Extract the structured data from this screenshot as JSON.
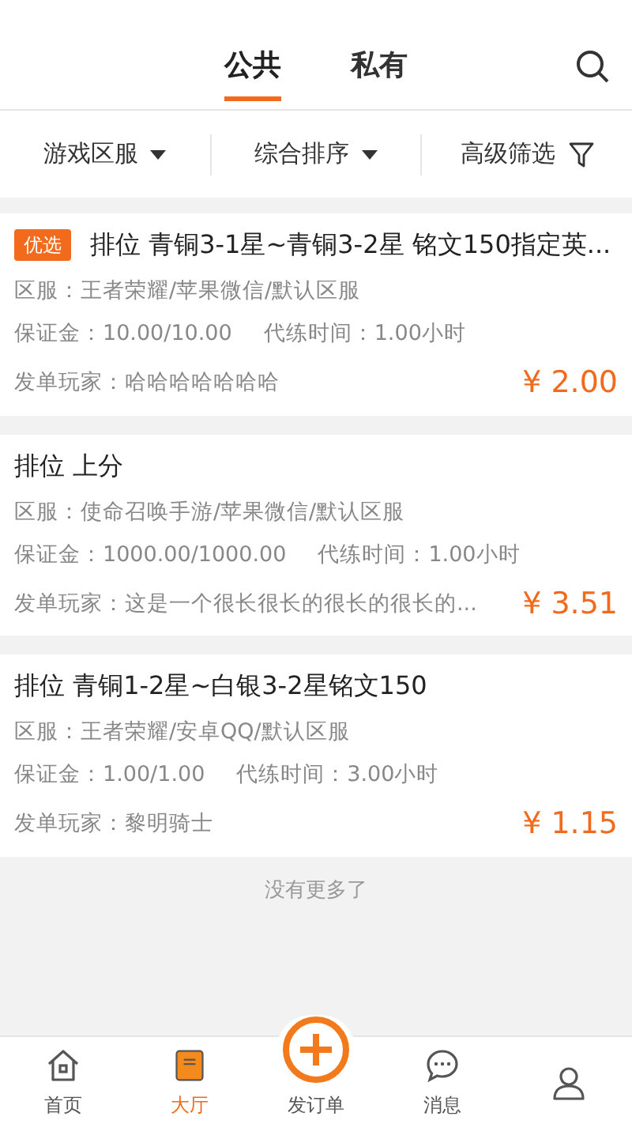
{
  "header": {
    "tabs": [
      {
        "label": "公共",
        "selected": true
      },
      {
        "label": "私有",
        "selected": false
      }
    ]
  },
  "filters": [
    {
      "label": "游戏区服",
      "kind": "dropdown"
    },
    {
      "label": "综合排序",
      "kind": "dropdown"
    },
    {
      "label": "高级筛选",
      "kind": "filter"
    }
  ],
  "orders": [
    {
      "badge": "优选",
      "title": "排位 青铜3-1星~青铜3-2星 铭文150指定英...",
      "region": "区服：王者荣耀/苹果微信/默认区服",
      "deposit": "保证金：10.00/10.00",
      "duration": "代练时间：1.00小时",
      "player": "发单玩家：哈哈哈哈哈哈哈",
      "price": "¥ 2.00"
    },
    {
      "title": "排位 上分",
      "region": "区服：使命召唤手游/苹果微信/默认区服",
      "deposit": "保证金：1000.00/1000.00",
      "duration": "代练时间：1.00小时",
      "player": "发单玩家：这是一个很长很长的很长的很长的...",
      "price": "¥ 3.51"
    },
    {
      "title": "排位 青铜1-2星~白银3-2星铭文150",
      "region": "区服：王者荣耀/安卓QQ/默认区服",
      "deposit": "保证金：1.00/1.00",
      "duration": "代练时间：3.00小时",
      "player": "发单玩家：黎明骑士",
      "price": "¥ 1.15"
    }
  ],
  "end_note": "没有更多了",
  "bottom_nav": [
    {
      "label": "首页",
      "kind": "home",
      "selected": false
    },
    {
      "label": "大厅",
      "kind": "hall",
      "selected": true
    },
    {
      "label": "发订单",
      "kind": "post",
      "selected": false
    },
    {
      "label": "消息",
      "kind": "message",
      "selected": false
    },
    {
      "kind": "profile",
      "selected": false
    }
  ]
}
